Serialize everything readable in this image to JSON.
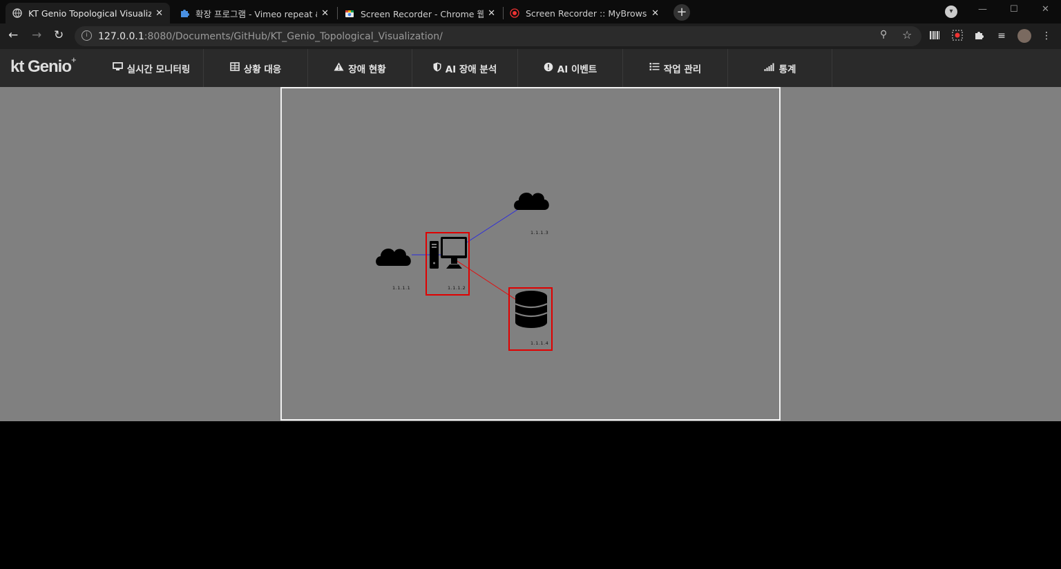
{
  "browser": {
    "tabs": [
      {
        "title": "KT Genio Topological Visualizati",
        "icon": "globe-icon"
      },
      {
        "title": "확장 프로그램 - Vimeo repeat &",
        "icon": "puzzle-icon"
      },
      {
        "title": "Screen Recorder - Chrome 웹 스",
        "icon": "webstore-icon"
      },
      {
        "title": "Screen Recorder :: MyBrowserAd",
        "icon": "record-icon"
      }
    ],
    "url_host": "127.0.0.1",
    "url_rest": ":8080/Documents/GitHub/KT_Genio_Topological_Visualization/"
  },
  "app": {
    "logo_main": "kt Genio",
    "logo_sup": "+",
    "menu": [
      {
        "label": "실시간 모니터링",
        "icon": "monitor-icon"
      },
      {
        "label": "상황 대응",
        "icon": "table-icon"
      },
      {
        "label": "장애 현황",
        "icon": "warning-icon"
      },
      {
        "label": "AI 장애 분석",
        "icon": "shield-icon"
      },
      {
        "label": "AI 이벤트",
        "icon": "exclamation-icon"
      },
      {
        "label": "작업 관리",
        "icon": "tasks-icon"
      },
      {
        "label": "통계",
        "icon": "signal-icon"
      }
    ]
  },
  "topology": {
    "nodes": [
      {
        "id": "cloud-1",
        "type": "cloud",
        "label": "1.1.1.1",
        "selected": false
      },
      {
        "id": "pc-2",
        "type": "computer",
        "label": "1.1.1.2",
        "selected": true
      },
      {
        "id": "cloud-3",
        "type": "cloud",
        "label": "1.1.1.3",
        "selected": false
      },
      {
        "id": "db-4",
        "type": "database",
        "label": "1.1.1.4",
        "selected": true
      }
    ],
    "links": [
      {
        "from": "cloud-1",
        "to": "pc-2",
        "color": "#2a2adf"
      },
      {
        "from": "pc-2",
        "to": "cloud-3",
        "color": "#2a2adf"
      },
      {
        "from": "pc-2",
        "to": "db-4",
        "color": "#e01010"
      }
    ],
    "selection_color": "#e00000"
  }
}
